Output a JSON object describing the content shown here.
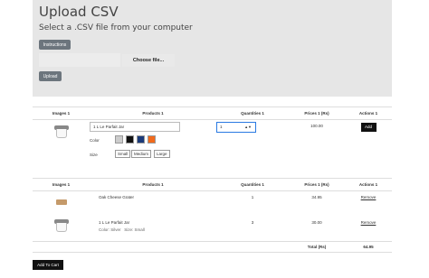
{
  "upload": {
    "title": "Upload CSV",
    "subtitle": "Select a .CSV file from your computer",
    "instructions_label": "Instructions",
    "choose_file_label": "Choose file...",
    "upload_label": "Upload"
  },
  "selector_table": {
    "headers": [
      "Images 1",
      "Products 1",
      "Quantities 1",
      "Prices 1 (Rs)",
      "Actions 1"
    ],
    "product_select": "1 L Le Parfait Jar",
    "color_label": "Color",
    "colors": [
      "#cccccc",
      "#111111",
      "#1a3a7a",
      "#f26a1b"
    ],
    "size_label": "Size",
    "sizes": [
      "Small",
      "Medium",
      "Large"
    ],
    "quantity": "1",
    "price": "100.00",
    "add_label": "Add"
  },
  "cart_table": {
    "headers": [
      "Images 1",
      "Products 1",
      "Quantities 1",
      "Prices 1 (Rs)",
      "Actions 1"
    ],
    "rows": [
      {
        "product": "Oak Cheese Grater",
        "details": "",
        "quantity": "1",
        "price": "34.95",
        "action": "Remove"
      },
      {
        "product": "1 L Le Parfait Jar",
        "details": "Color: Silver   Size: Small",
        "quantity": "3",
        "price": "30.00",
        "action": "Remove"
      }
    ],
    "total_label": "Total (Rs)",
    "total_value": "64.95"
  },
  "add_to_cart_label": "Add To Cart"
}
